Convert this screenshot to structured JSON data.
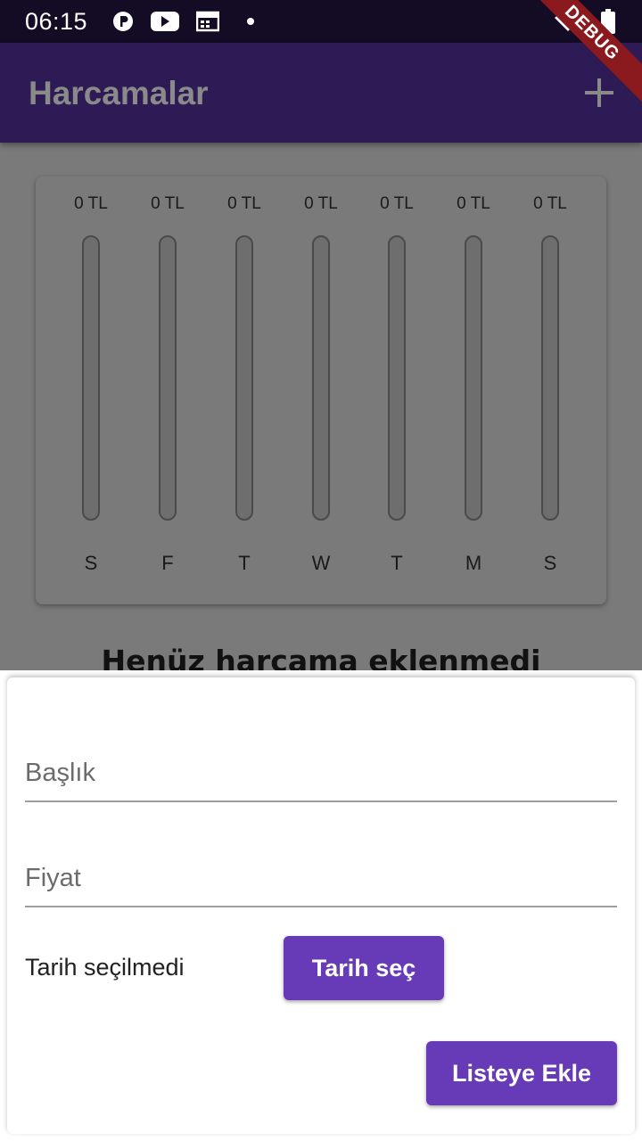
{
  "status_bar": {
    "time": "06:15",
    "icons": [
      "p-notification-icon",
      "youtube-icon",
      "calendar-icon",
      "dot-icon",
      "wifi-icon",
      "battery-icon"
    ]
  },
  "debug_banner": "DEBUG",
  "app_bar": {
    "title": "Harcamalar",
    "add_icon": "plus-icon"
  },
  "chart": {
    "bars": [
      {
        "amount": "0 TL",
        "day": "S",
        "fraction": 0
      },
      {
        "amount": "0 TL",
        "day": "F",
        "fraction": 0
      },
      {
        "amount": "0 TL",
        "day": "T",
        "fraction": 0
      },
      {
        "amount": "0 TL",
        "day": "W",
        "fraction": 0
      },
      {
        "amount": "0 TL",
        "day": "T",
        "fraction": 0
      },
      {
        "amount": "0 TL",
        "day": "M",
        "fraction": 0
      },
      {
        "amount": "0 TL",
        "day": "S",
        "fraction": 0
      }
    ]
  },
  "empty_message": "Henüz harcama eklenmedi",
  "form": {
    "title_placeholder": "Başlık",
    "price_placeholder": "Fiyat",
    "date_status": "Tarih seçilmedi",
    "pick_date_label": "Tarih seç",
    "submit_label": "Listeye Ekle"
  },
  "colors": {
    "primary": "#673ab7",
    "app_bar": "#2e1a55",
    "status_bar": "#140c24",
    "debug_banner": "#8a1a1e"
  }
}
